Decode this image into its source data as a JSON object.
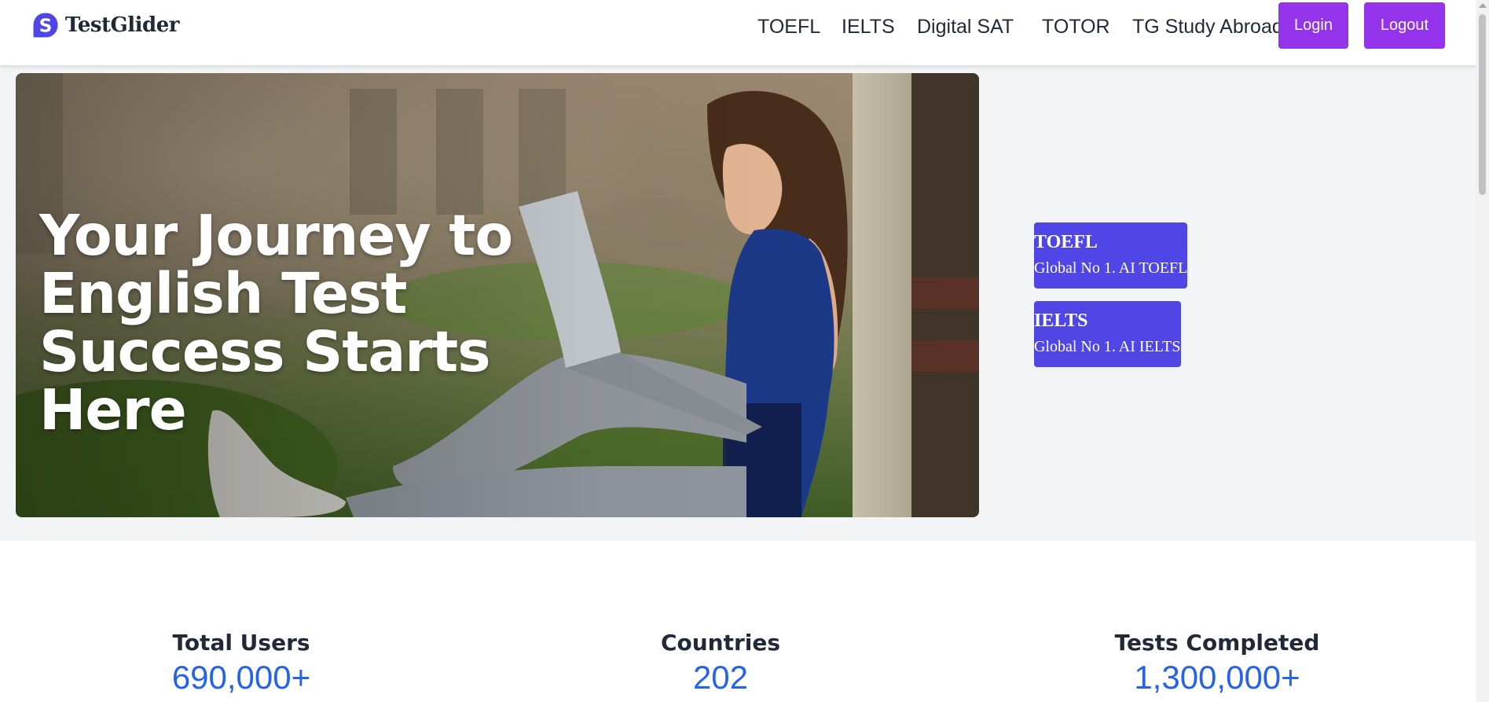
{
  "header": {
    "logo_text": "TestGlider",
    "nav": [
      "TOEFL",
      "IELTS",
      "Digital SAT",
      "TOTOR",
      "TG Study Abroad"
    ],
    "login_label": "Login",
    "logout_label": "Logout"
  },
  "hero": {
    "title": "Your Journey to English Test Success Starts Here"
  },
  "tests": [
    {
      "title": "TOEFL",
      "subtitle": "Global No 1. AI TOEFL"
    },
    {
      "title": "IELTS",
      "subtitle": "Global No 1. AI IELTS"
    }
  ],
  "stats": [
    {
      "label": "Total Users",
      "value": "690,000+"
    },
    {
      "label": "Countries",
      "value": "202"
    },
    {
      "label": "Tests Completed",
      "value": "1,300,000+"
    }
  ],
  "colors": {
    "brand": "#4f46e5",
    "button": "#9333ea",
    "stat_value": "#2563eb",
    "hero_background": "#f3f4f6"
  }
}
